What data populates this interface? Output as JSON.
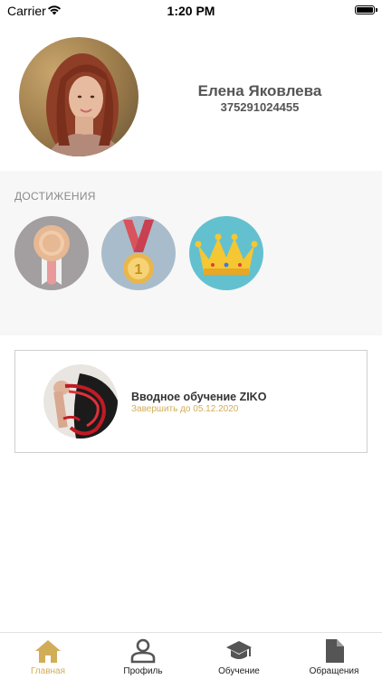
{
  "status_bar": {
    "carrier": "Carrier",
    "time": "1:20 PM"
  },
  "profile": {
    "name": "Елена Яковлева",
    "phone": "375291024455"
  },
  "achievements": {
    "title": "ДОСТИЖЕНИЯ",
    "badges": [
      "ribbon-medal-icon",
      "first-place-medal-icon",
      "crown-icon"
    ]
  },
  "course": {
    "title": "Вводное обучение ZIKO",
    "deadline": "Завершить до 05.12.2020"
  },
  "tabbar": {
    "items": [
      {
        "label": "Главная",
        "icon": "home-icon",
        "active": true
      },
      {
        "label": "Профиль",
        "icon": "person-icon",
        "active": false
      },
      {
        "label": "Обучение",
        "icon": "graduation-cap-icon",
        "active": false
      },
      {
        "label": "Обращения",
        "icon": "document-icon",
        "active": false
      }
    ]
  },
  "colors": {
    "accent": "#d2ad58",
    "section_bg": "#f7f7f7",
    "text_dark": "#555555"
  }
}
